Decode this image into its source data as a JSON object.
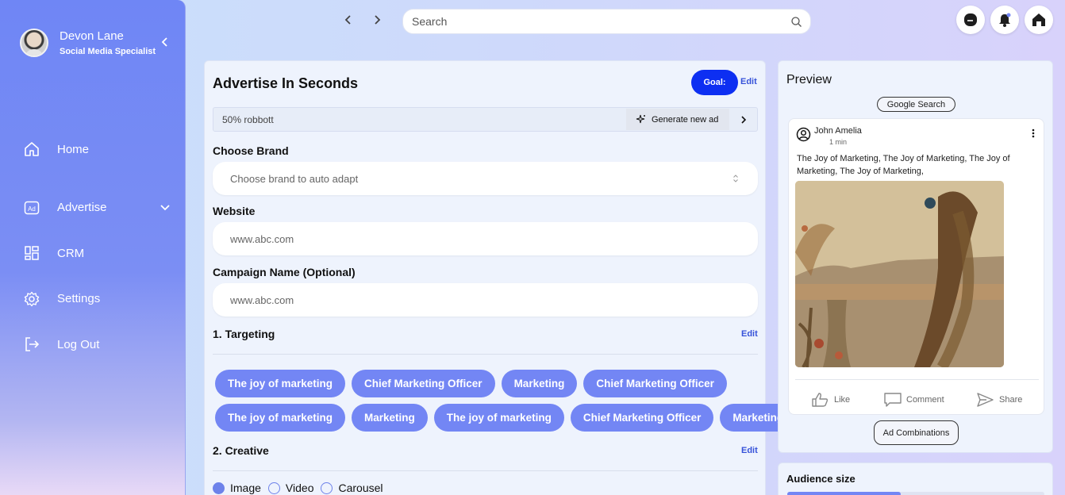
{
  "profile": {
    "name": "Devon Lane",
    "role": "Social Media Specialist"
  },
  "sidebar": {
    "items": [
      {
        "label": "Home",
        "icon": "home-icon"
      },
      {
        "label": "Advertise",
        "icon": "ad-icon"
      },
      {
        "label": "CRM",
        "icon": "grid-icon"
      },
      {
        "label": "Settings",
        "icon": "gear-icon"
      },
      {
        "label": "Log Out",
        "icon": "logout-icon"
      }
    ]
  },
  "topbar": {
    "search_placeholder": "Search"
  },
  "form": {
    "title": "Advertise In Seconds",
    "goal_label": "Goal:",
    "edit_label": "Edit",
    "prompt_value": "50% robbott",
    "generate_label": "Generate new ad",
    "brand_label": "Choose Brand",
    "brand_placeholder": "Choose brand to auto adapt",
    "website_label": "Website",
    "website_placeholder": "www.abc.com",
    "campaign_label": "Campaign Name (Optional)",
    "campaign_placeholder": "www.abc.com",
    "targeting_title": "1. Targeting",
    "targeting_tags_row1": [
      "The joy of marketing",
      "Chief Marketing Officer",
      "Marketing",
      "Chief Marketing Officer"
    ],
    "targeting_tags_row2": [
      "The joy of marketing",
      "Marketing",
      "The joy of marketing",
      "Chief Marketing Officer",
      "Marketing"
    ],
    "creative_title": "2. Creative",
    "creative_options": [
      "Image",
      "Video",
      "Carousel"
    ],
    "creative_selected": "Image"
  },
  "preview": {
    "title": "Preview",
    "channel": "Google Search",
    "post_user": "John Amelia",
    "post_time": "1 min",
    "post_text": "The Joy of Marketing, The Joy of Marketing, The Joy of Marketing, The Joy of Marketing,",
    "actions": [
      "Like",
      "Comment",
      "Share"
    ],
    "combinations_label": "Ad Combinations"
  },
  "audience": {
    "title": "Audience size",
    "level": 0.44
  },
  "colors": {
    "accent": "#7386f4",
    "goal": "#0d2ff2",
    "sidebar": "#6f86f5"
  }
}
